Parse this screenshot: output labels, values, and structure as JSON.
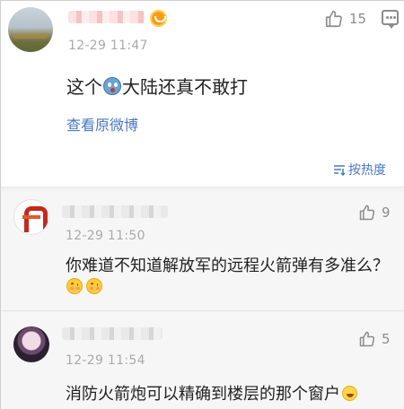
{
  "main_comment": {
    "timestamp": "12-29 11:47",
    "like_count": "15",
    "text_before_emoji": "这个",
    "text_after_emoji": "大陆还真不敢打",
    "view_original_label": "查看原微博",
    "emoji_icon": "scared-face-emoji"
  },
  "sort": {
    "label": "按热度",
    "icon": "sort-icon"
  },
  "replies": [
    {
      "timestamp": "12-29 11:50",
      "like_count": "9",
      "text": "你难道不知道解放军的远程火箭弹有多准么？",
      "emojis": [
        "blush-face-emoji",
        "blush-face-emoji"
      ]
    },
    {
      "timestamp": "12-29 11:54",
      "like_count": "5",
      "text": "消防火箭炮可以精确到楼层的那个窗户",
      "emojis": [
        "laugh-face-emoji"
      ]
    }
  ],
  "colors": {
    "link_blue": "#4a78c2",
    "meta_gray": "#aaaaaa",
    "reply_background": "#f6f6f6",
    "badge_orange": "#ff9b1a"
  }
}
